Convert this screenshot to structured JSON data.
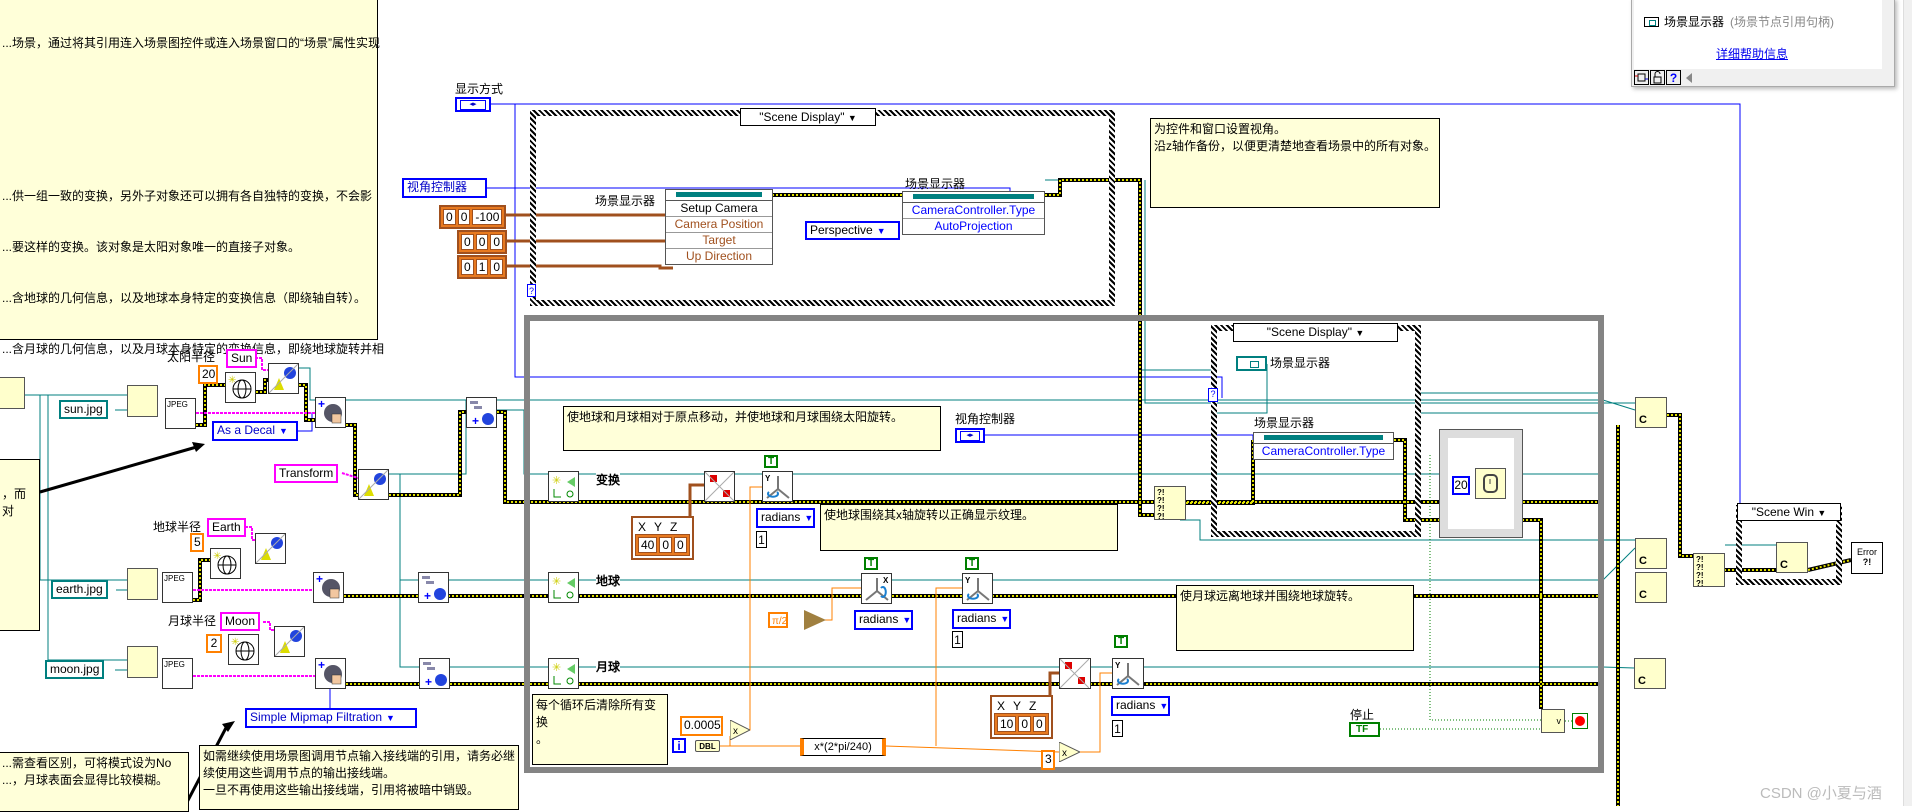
{
  "comments": {
    "top_left": [
      "...场景，通过将其引用连入场景图控件或连入场景窗口的“场景”属性实现",
      "",
      "",
      "...供一组一致的变换，另外子对象还可以拥有各自独特的变换，不会影",
      "...要这样的变换。该对象是太阳对象唯一的直接子对象。",
      "...含地球的几何信息，以及地球本身特定的变换信息（即绕轴自转）。",
      "...含月球的几何信息，以及月球本身特定的变换信息，即绕地球旋转并相"
    ],
    "left_mid": "，而对",
    "bottom_left": "...需查看区别，可将模式设为No\n...，月球表面会显得比较模糊。",
    "bottom_left_bold": "No",
    "bottom_mid": "如需继续使用场景图调用节点输入接线端的引用，请务必继续使用这些调用节点的输出接线端。\n一旦不再使用这些输出接线端，引用将被暗中销毁。",
    "camera": "为控件和窗口设置视角。\n沿z轴作备份，以便更清楚地查看场景中的所有对象。",
    "move": "使地球和月球相对于原点移动，并使地球和月球围绕太阳旋转。",
    "earth_rotate": "使地球围绕其x轴旋转以正确显示纹理。",
    "moon_rotate": "使月球远离地球并围绕地球旋转。",
    "clear": "每个循环后清除所有变换\n。"
  },
  "help_panel": {
    "item_label": "场景显示器",
    "item_type": "(场景节点引用句柄)",
    "link": "详细帮助信息",
    "toolbar_help": "?"
  },
  "top_case": {
    "selector": "\"Scene Display\"",
    "display_mode_label": "显示方式",
    "view_controller_label": "视角控制器",
    "position": [
      "0",
      "0",
      "-100"
    ],
    "target": [
      "0",
      "0",
      "0"
    ],
    "up": [
      "0",
      "1",
      "0"
    ],
    "prop1": {
      "label": "场景显示器",
      "rows": [
        "Setup Camera",
        "Camera Position",
        "Target",
        "Up Direction"
      ]
    },
    "prop2": {
      "label": "场景显示器",
      "rows": [
        "CameraController.Type",
        "AutoProjection"
      ]
    },
    "projection_enum": "Perspective"
  },
  "objects": {
    "sun": {
      "radius_label": "太阳半径",
      "radius": "20",
      "name": "Sun",
      "file": "sun.jpg"
    },
    "earth": {
      "radius_label": "地球半径",
      "radius": "5",
      "name": "Earth",
      "file": "earth.jpg"
    },
    "moon": {
      "radius_label": "月球半径",
      "radius": "2",
      "name": "Moon",
      "file": "moon.jpg"
    },
    "decal_enum": "As a Decal",
    "transform_name": "Transform",
    "mipmap_enum": "Simple Mipmap Filtration",
    "jpeg": "JPEG"
  },
  "loop": {
    "row_transform": "变换",
    "row_earth": "地球",
    "row_moon": "月球",
    "translate1": [
      "40",
      "0",
      "0"
    ],
    "translate2": [
      "10",
      "0",
      "0"
    ],
    "xyz": [
      "X",
      "Y",
      "Z"
    ],
    "true_const": "T",
    "units": "radians",
    "one": "1",
    "pi_half": "π/2",
    "rate": "0.0005",
    "iteration": "i",
    "dbl": "DBL",
    "formula": "x*(2*pi/240)",
    "three": "3",
    "multiply": "x",
    "view_controller_label": "视角控制器",
    "inner_selector": "\"Scene Display\"",
    "inner_ref_label": "场景显示器",
    "inner_prop_label": "场景显示器",
    "inner_prop_row": "CameraController.Type",
    "wait_ms": "20",
    "stop_label": "停止",
    "stop_bool": "TF",
    "or_label": "v"
  },
  "right": {
    "selector": "\"Scene Win",
    "error": "Error",
    "error_sub": "?!",
    "close_c": "C"
  },
  "watermark": "CSDN @小夏与酒",
  "colors": {
    "refnum": "#007f7f",
    "enum": "#0000ff",
    "dbl": "#ff8000",
    "string": "#ff00ff",
    "array": "#a0501e",
    "error": "#d8d800",
    "bool": "#007f00",
    "comment": "#ffffd9"
  }
}
